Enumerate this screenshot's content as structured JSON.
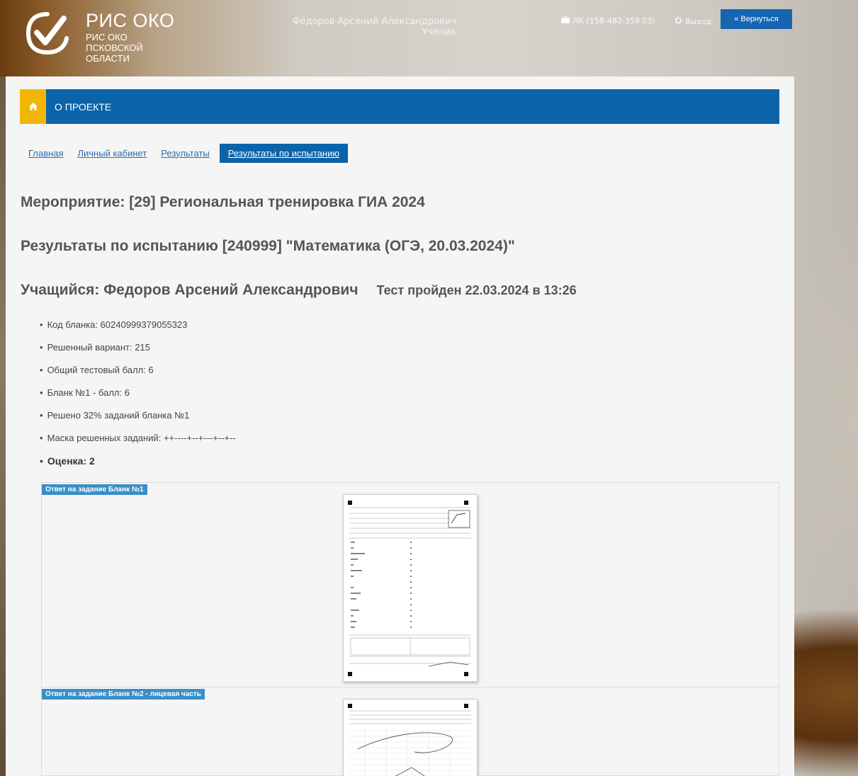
{
  "header": {
    "brand_title": "РИС ОКО",
    "brand_subtitle": "РИС ОКО ПСКОВСКОЙ ОБЛАСТИ",
    "user_name": "Фёдоров Арсений Александрович",
    "user_role": "Ученик",
    "lk_label": "ЛК (158-482-359 03)",
    "exit_label": "Выход",
    "back_label": "Вернуться"
  },
  "navbar": {
    "item": "О ПРОЕКТЕ"
  },
  "breadcrumbs": [
    "Главная",
    "Личный кабинет",
    "Результаты",
    "Результаты по испытанию"
  ],
  "event_line": "Мероприятие: [29] Региональная тренировка ГИА 2024",
  "test_line": "Результаты по испытанию [240999] \"Математика (ОГЭ, 20.03.2024)\"",
  "student_line": "Учащийся: Федоров Арсений Александрович",
  "passed_line": "Тест пройден 22.03.2024 в 13:26",
  "facts": [
    "Код бланка: 60240999379055323",
    "Решенный вариант: 215",
    "Общий тестовый балл: 6",
    "Бланк №1 - балл: 6",
    "Решено 32% заданий бланка №1",
    "Маска решенных заданий: ++----+--+---+--+--"
  ],
  "grade": "Оценка: 2",
  "answers": [
    {
      "label": "Ответ на задание Бланк №1"
    },
    {
      "label": "Ответ на задание Бланк №2 - лицевая часть"
    }
  ],
  "colors": {
    "primary_blue": "#0b63a8",
    "home_yellow": "#f2b705",
    "label_blue": "#3a8ec7"
  }
}
